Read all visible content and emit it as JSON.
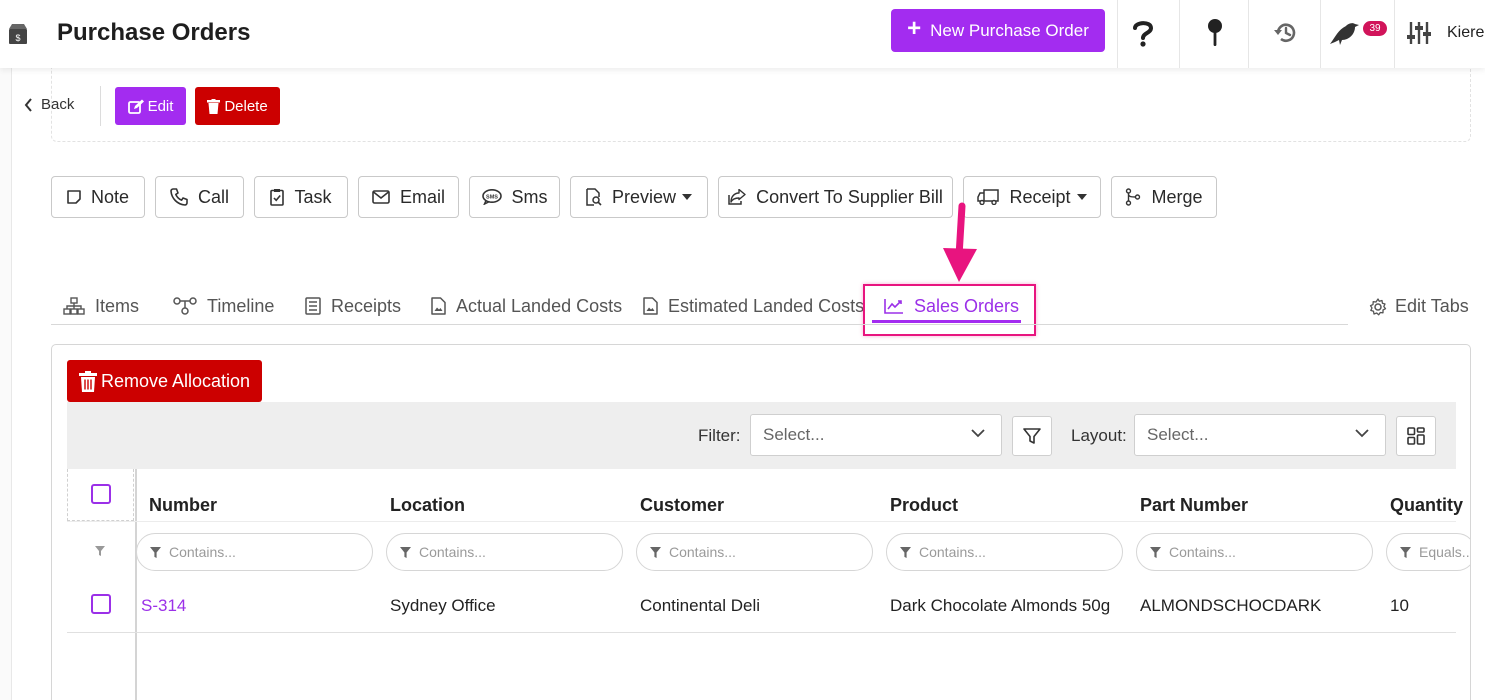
{
  "header": {
    "title": "Purchase Orders",
    "new_button_label": "New Purchase Order",
    "notification_count": "39",
    "user_name": "Kieren"
  },
  "actions": {
    "back_label": "Back",
    "edit_label": "Edit",
    "delete_label": "Delete"
  },
  "activity_buttons": {
    "note": "Note",
    "call": "Call",
    "task": "Task",
    "email": "Email",
    "sms": "Sms",
    "preview": "Preview",
    "convert": "Convert To Supplier Bill",
    "receipt": "Receipt",
    "merge": "Merge"
  },
  "tabs": {
    "items": "Items",
    "timeline": "Timeline",
    "receipts": "Receipts",
    "actual_landed_costs": "Actual Landed Costs",
    "estimated_landed_costs": "Estimated Landed Costs",
    "sales_orders": "Sales Orders",
    "edit_tabs": "Edit Tabs",
    "active": "Sales Orders"
  },
  "panel": {
    "remove_allocation_label": "Remove Allocation",
    "filter_label": "Filter:",
    "filter_placeholder": "Select...",
    "layout_label": "Layout:",
    "layout_placeholder": "Select..."
  },
  "grid": {
    "columns": {
      "number": "Number",
      "location": "Location",
      "customer": "Customer",
      "product": "Product",
      "part_number": "Part Number",
      "quantity": "Quantity"
    },
    "filter_placeholders": {
      "contains": "Contains...",
      "equals": "Equals..."
    },
    "rows": [
      {
        "number": "S-314",
        "location": "Sydney Office",
        "customer": "Continental Deli",
        "product": "Dark Chocolate Almonds 50g",
        "part_number": "ALMONDSCHOCDARK",
        "quantity": "10"
      }
    ]
  },
  "colors": {
    "accent": "#a32cf0",
    "danger": "#cc0000",
    "highlight": "#e8147f"
  }
}
